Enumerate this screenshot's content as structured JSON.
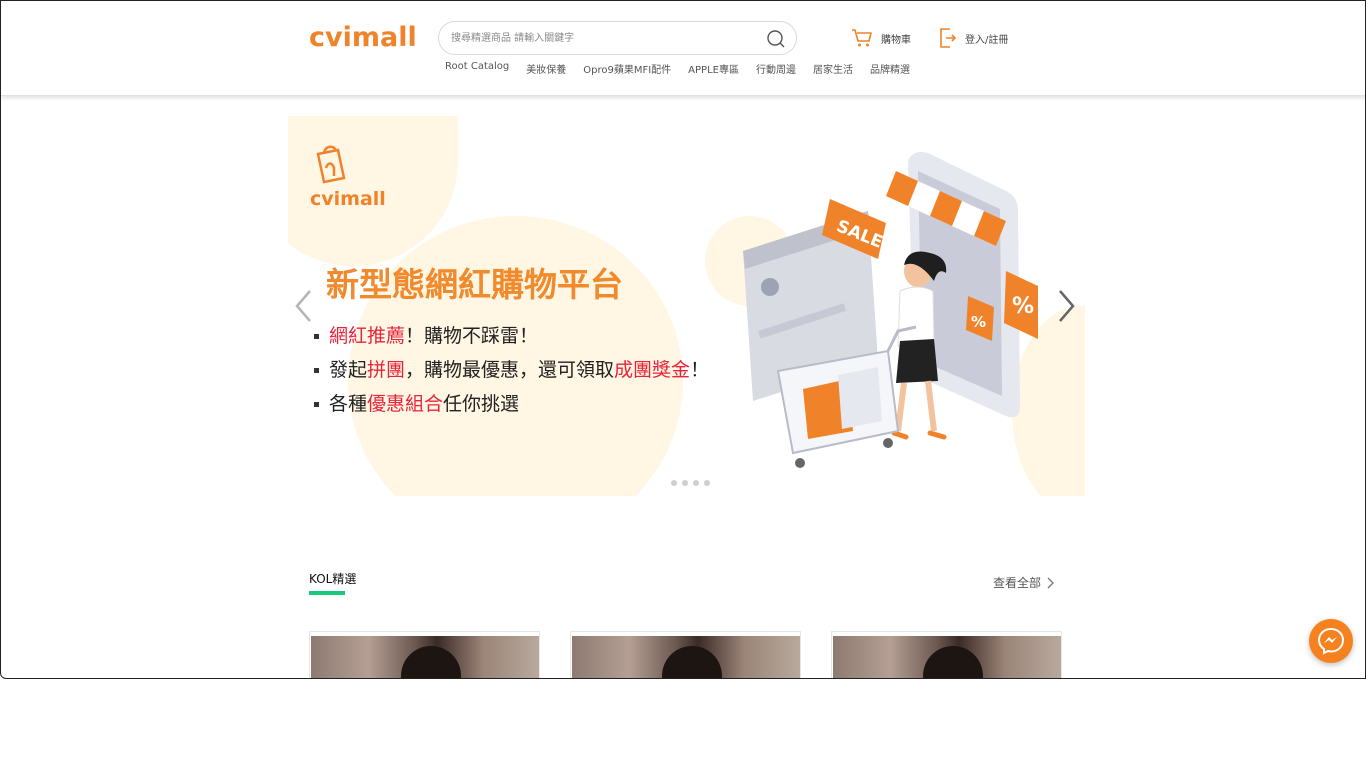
{
  "header": {
    "logo_text": "cvimall",
    "search": {
      "placeholder": "搜尋精選商品 請輸入關鍵字"
    },
    "cart_label": "購物車",
    "login_label": "登入/註冊",
    "nav_items": [
      "Root Catalog",
      "美妝保養",
      "Opro9蘋果MFI配件",
      "APPLE專區",
      "行動周邊",
      "居家生活",
      "品牌精選"
    ]
  },
  "banner": {
    "logo_text": "cvimall",
    "headline": "新型態網紅購物平台",
    "line1": {
      "hl": "網紅推薦",
      "rest": "！購物不踩雷！"
    },
    "line2": {
      "a": "發起",
      "hl1": "拼團",
      "b": "，購物最優惠，還可領取",
      "hl2": "成團獎金",
      "c": "！"
    },
    "line3": {
      "a": "各種",
      "hl": "優惠組合",
      "b": "任你挑選"
    },
    "sale_tag": "SALE",
    "percent_tag": "%",
    "slide_count": 4
  },
  "kol_section": {
    "title": "KOL精選",
    "view_all": "查看全部"
  },
  "colors": {
    "brand_orange": "#f0832a",
    "highlight_red": "#e8243c",
    "section_underline": "#16c97e",
    "messenger": "#f5821f"
  },
  "icons": {
    "search": "search-icon",
    "cart": "cart-icon",
    "login": "login-icon",
    "prev": "chevron-left-icon",
    "next": "chevron-right-icon",
    "view_all": "chevron-right-icon",
    "messenger": "messenger-icon"
  }
}
